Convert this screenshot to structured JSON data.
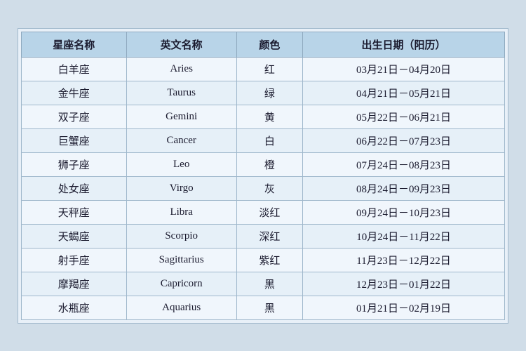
{
  "table": {
    "headers": [
      "星座名称",
      "英文名称",
      "颜色",
      "出生日期（阳历）"
    ],
    "rows": [
      [
        "白羊座",
        "Aries",
        "红",
        "03月21日－04月20日"
      ],
      [
        "金牛座",
        "Taurus",
        "绿",
        "04月21日－05月21日"
      ],
      [
        "双子座",
        "Gemini",
        "黄",
        "05月22日－06月21日"
      ],
      [
        "巨蟹座",
        "Cancer",
        "白",
        "06月22日－07月23日"
      ],
      [
        "狮子座",
        "Leo",
        "橙",
        "07月24日－08月23日"
      ],
      [
        "处女座",
        "Virgo",
        "灰",
        "08月24日－09月23日"
      ],
      [
        "天秤座",
        "Libra",
        "淡红",
        "09月24日－10月23日"
      ],
      [
        "天蝎座",
        "Scorpio",
        "深红",
        "10月24日－11月22日"
      ],
      [
        "射手座",
        "Sagittarius",
        "紫红",
        "11月23日－12月22日"
      ],
      [
        "摩羯座",
        "Capricorn",
        "黑",
        "12月23日－01月22日"
      ],
      [
        "水瓶座",
        "Aquarius",
        "黑",
        "01月21日－02月19日"
      ]
    ]
  }
}
